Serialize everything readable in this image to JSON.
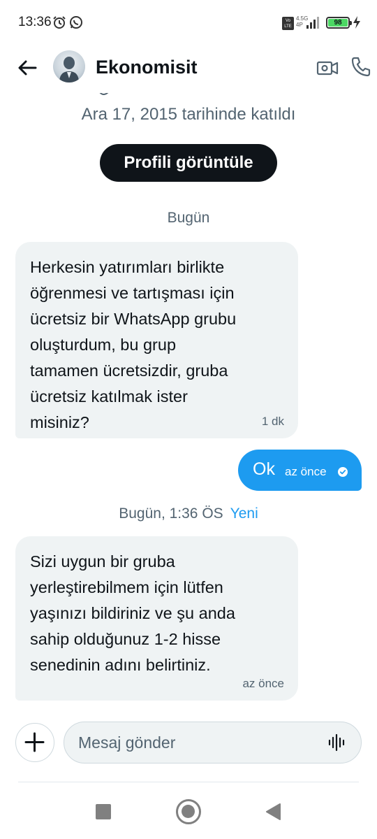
{
  "status_bar": {
    "time": "13:36",
    "network": "4.5G",
    "network_sub": "4P",
    "battery": "98",
    "volte": "Vo LTE"
  },
  "header": {
    "name": "Ekonomisit",
    "icons": [
      "back-arrow-icon",
      "video-camera-icon",
      "phone-icon"
    ]
  },
  "conversation": {
    "joined": "Ara 17, 2015 tarihinde katıldı",
    "profile_button": "Profili görüntüle",
    "separators": [
      {
        "label": "Bugün",
        "badge": ""
      },
      {
        "label": "Bugün, 1:36 ÖS",
        "badge": "Yeni"
      }
    ],
    "messages": [
      {
        "direction": "incoming",
        "text": "Herkesin yatırımları birlikte\nöğrenmesi ve tartışması için\nücretsiz bir WhatsApp grubu\noluşturdum, bu grup\ntamamen ücretsizdir, gruba\nücretsiz katılmak ister\nmisiniz?",
        "time": "1 dk"
      },
      {
        "direction": "outgoing",
        "text": "Ok",
        "time": "az önce",
        "status": "seen"
      },
      {
        "direction": "incoming",
        "text": "Sizi uygun bir gruba\nyerleştirebilmem için lütfen\nyaşınızı bildiriniz ve şu anda\nsahip olduğunuz 1-2 hisse\nsenedinin adını belirtiniz.",
        "time": "az önce"
      }
    ]
  },
  "composer": {
    "placeholder": "Mesaj gönder",
    "value": ""
  },
  "colors": {
    "accent": "#1d9bf0",
    "incoming_bubble": "#eff3f4",
    "text_primary": "#0f1419",
    "text_secondary": "#536471"
  }
}
